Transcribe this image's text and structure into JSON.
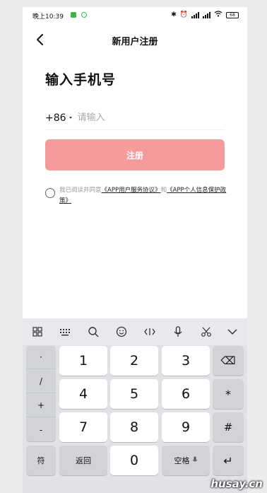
{
  "status_bar": {
    "time": "晚上10:39",
    "battery": "68"
  },
  "header": {
    "title": "新用户注册"
  },
  "form": {
    "heading": "输入手机号",
    "country_code": "+86",
    "phone_placeholder": "请输入",
    "register_label": "注册"
  },
  "agreement": {
    "prefix": "我已阅读并同意",
    "link1": "《APP用户服务协议》",
    "joiner": "和",
    "link2": "《APP个人信息保护政策》"
  },
  "keyboard": {
    "toolbar_icons": [
      "grid-icon",
      "keyboard-icon",
      "search-icon",
      "emoji-icon",
      "cursor-icon",
      "microphone-icon",
      "scissors-icon",
      "collapse-chevron-icon"
    ],
    "side_keys": [
      "·",
      "/",
      "+",
      "-"
    ],
    "digits": [
      "1",
      "2",
      "3",
      "4",
      "5",
      "6",
      "7",
      "8",
      "9",
      "0"
    ],
    "right_keys": [
      "⌫",
      "*",
      "#"
    ],
    "symbol_key": "符",
    "back_key": "返回",
    "space_key": "空格",
    "enter_key": "↵"
  },
  "watermark": "husay.cn",
  "colors": {
    "register_button": "#f59b9b",
    "keyboard_bg": "#e1e2e6"
  }
}
